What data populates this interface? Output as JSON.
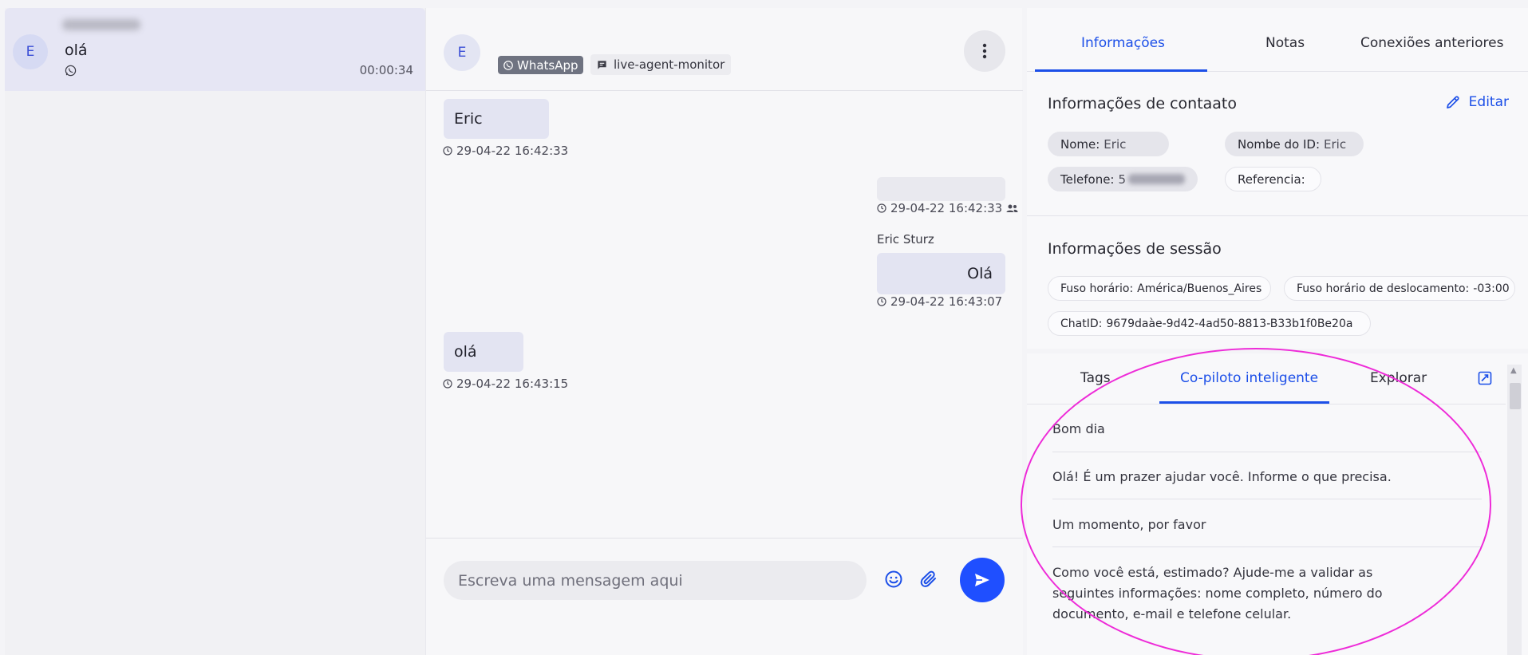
{
  "conversation_list": {
    "items": [
      {
        "avatar_initial": "E",
        "preview": "olá",
        "channel_icon": "whatsapp-icon",
        "duration": "00:00:34"
      }
    ]
  },
  "chat": {
    "header": {
      "avatar_initial": "E",
      "channel_label": "WhatsApp",
      "agent_label": "live-agent-monitor",
      "menu_icon": "more-vertical-icon"
    },
    "messages": [
      {
        "text": "Eric",
        "timestamp": "29-04-22 16:42:33",
        "direction": "incoming"
      },
      {
        "text": "",
        "timestamp": "29-04-22 16:42:33",
        "direction": "outgoing",
        "icon": "users-icon"
      },
      {
        "sender": "Eric Sturz",
        "text": "Olá",
        "timestamp": "29-04-22 16:43:07",
        "direction": "outgoing"
      },
      {
        "text": "olá",
        "timestamp": "29-04-22 16:43:15",
        "direction": "incoming"
      }
    ],
    "composer": {
      "placeholder": "Escreva uma mensagem aqui",
      "emoji_icon": "smile-icon",
      "attach_icon": "paperclip-icon",
      "send_icon": "send-icon"
    }
  },
  "details": {
    "tabs": [
      "Informações",
      "Notas",
      "Conexiões anteriores"
    ],
    "active_tab": "Informações",
    "contact": {
      "title": "Informações de contaato",
      "edit_label": "Editar",
      "fields": [
        {
          "key": "Nome:",
          "value": "Eric"
        },
        {
          "key": "Nombe do ID:",
          "value": "Eric"
        },
        {
          "key": "Telefone:",
          "value": "5"
        },
        {
          "key": "Referencia:",
          "value": ""
        }
      ]
    },
    "session": {
      "title": "Informações de sessão",
      "fields": [
        {
          "key": "Fuso horário:",
          "value": "América/Buenos_Aires"
        },
        {
          "key": "Fuso horário de deslocamento:",
          "value": "-03:00"
        },
        {
          "key": "ChatID:",
          "value": "9679daàe-9d42-4ad50-8813-B33b1f0Be20a"
        }
      ]
    }
  },
  "copilot": {
    "tabs": [
      "Tags",
      "Co-piloto inteligente",
      "Explorar"
    ],
    "active_tab": "Co-piloto inteligente",
    "expand_icon": "expand-chart-icon",
    "suggestions": [
      "Bom dia",
      "Olá! É um prazer ajudar você. Informe o que precisa.",
      "Um momento, por favor",
      "Como você está, estimado? Ajude-me a validar as seguintes informações: nome completo, número do documento, e-mail e telefone celular."
    ]
  },
  "colors": {
    "accent": "#1c4fe8",
    "send_button": "#1f4fff",
    "highlight": "#ee2bd8"
  }
}
